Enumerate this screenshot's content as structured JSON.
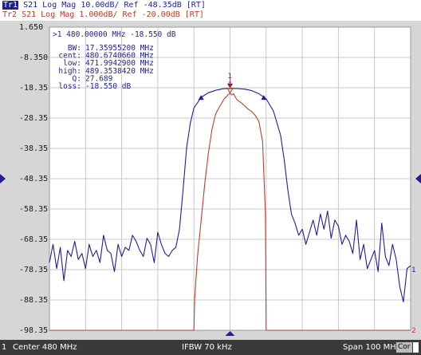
{
  "legend": {
    "tr1_tag": "Tr1",
    "tr1_text": " S21 Log Mag 10.00dB/ Ref -48.35dB [RT]",
    "tr2_text": "Tr2 S21 Log Mag 1.000dB/ Ref -20.00dB [RT]"
  },
  "colors": {
    "trace1": "#1f1f9a",
    "trace2": "#c23b2c",
    "grid": "#c9c9c9",
    "plot_bg": "#ffffff",
    "marker": "#1f1f9a"
  },
  "marker_readout": {
    "line1": ">1  480.00000 MHz -18.550 dB",
    "rows": [
      {
        "label": "BW:",
        "value": "17.35955200 MHz"
      },
      {
        "label": "cent:",
        "value": "480.6740660 MHz"
      },
      {
        "label": "low:",
        "value": "471.9942900 MHz"
      },
      {
        "label": "high:",
        "value": "489.3538420 MHz"
      },
      {
        "label": "Q:",
        "value": "27.689"
      },
      {
        "label": "loss:",
        "value": "-18.550 dB"
      }
    ]
  },
  "marker_labels": {
    "trace1_marker": "1",
    "trace2_marker": "1",
    "trace1_end": "1",
    "trace2_end": "2"
  },
  "status": {
    "channel": "1",
    "center": "Center 480 MHz",
    "ifbw": "IFBW 70 kHz",
    "span": "Span 100 MHz",
    "cor": "Cor"
  },
  "chart_data": {
    "type": "line",
    "title": "",
    "xlabel": "",
    "ylabel": "",
    "xlim": [
      430,
      530
    ],
    "x_unit": "MHz",
    "y_ticks": [
      "1.650",
      "-8.350",
      "-18.35",
      "-28.35",
      "-38.35",
      "-48.35",
      "-58.35",
      "-68.35",
      "-78.35",
      "-88.35",
      "-98.35"
    ],
    "ylim": [
      -98.35,
      1.65
    ],
    "grid": true,
    "reference_level": -48.35,
    "bandwidth_markers_x": [
      471.99,
      489.35
    ],
    "series": [
      {
        "name": "Tr1",
        "x": [
          430,
          431,
          432,
          433,
          434,
          435,
          436,
          437,
          438,
          439,
          440,
          441,
          442,
          443,
          444,
          445,
          446,
          447,
          448,
          449,
          450,
          451,
          452,
          453,
          454,
          455,
          456,
          457,
          458,
          459,
          460,
          461,
          462,
          463,
          464,
          465,
          466,
          467,
          468,
          469,
          470,
          472,
          474,
          476,
          478,
          480,
          482,
          484,
          486,
          488,
          490,
          492,
          494,
          495,
          496,
          497,
          498,
          499,
          500,
          501,
          502,
          503,
          504,
          505,
          506,
          507,
          508,
          509,
          510,
          511,
          512,
          513,
          514,
          515,
          516,
          517,
          518,
          519,
          520,
          521,
          522,
          523,
          524,
          525,
          526,
          527,
          528,
          529,
          530
        ],
        "values": [
          -76,
          -70,
          -78,
          -71,
          -82,
          -72,
          -74,
          -69,
          -75,
          -73,
          -78,
          -70,
          -74,
          -72,
          -76,
          -67,
          -72,
          -73,
          -79,
          -70,
          -74,
          -71,
          -72,
          -67,
          -69,
          -72,
          -74,
          -68,
          -70,
          -76,
          -66,
          -70,
          -73,
          -74,
          -72,
          -71,
          -65,
          -52,
          -38,
          -30,
          -25,
          -21.5,
          -20,
          -19.2,
          -18.7,
          -18.55,
          -18.6,
          -18.8,
          -19.3,
          -20.3,
          -22,
          -26,
          -34,
          -42,
          -52,
          -60,
          -63,
          -67,
          -65,
          -70,
          -66,
          -62,
          -67,
          -60,
          -65,
          -59,
          -68,
          -62,
          -64,
          -70,
          -67,
          -69,
          -73,
          -62,
          -75,
          -70,
          -78,
          -75,
          -72,
          -79,
          -63,
          -74,
          -77,
          -70,
          -75,
          -84,
          -89,
          -78,
          -77
        ]
      },
      {
        "name": "Tr2",
        "x": [
          430,
          465,
          470,
          470.2,
          471,
          472,
          473,
          474,
          475,
          476,
          477,
          478,
          478.5,
          479,
          479.5,
          480,
          480.5,
          481,
          481.5,
          482,
          483,
          484,
          485,
          486,
          487,
          488,
          489,
          489.8,
          490,
          495,
          530
        ],
        "values": [
          -98.35,
          -98.35,
          -98.35,
          -88,
          -74,
          -62,
          -50,
          -40,
          -32,
          -27,
          -24.8,
          -22.8,
          -21.8,
          -21.3,
          -20.6,
          -20.1,
          -20.7,
          -20.3,
          -21.5,
          -22.4,
          -23.2,
          -24.3,
          -25.4,
          -26.2,
          -27.5,
          -29.5,
          -36,
          -60,
          -98.35,
          -98.35,
          -98.35
        ]
      }
    ]
  }
}
